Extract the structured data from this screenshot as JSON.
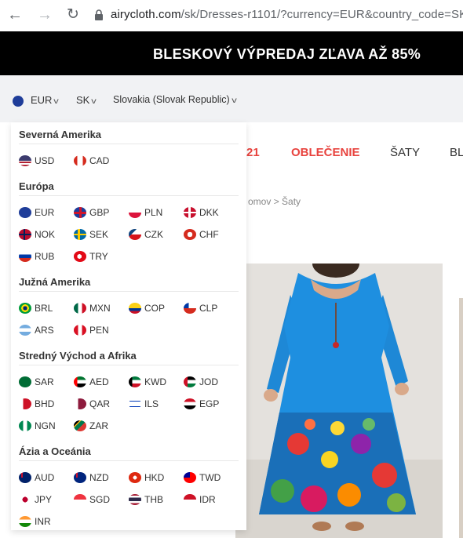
{
  "browser": {
    "back_icon": "←",
    "forward_icon": "→",
    "reload_icon": "↻",
    "url_domain": "airycloth.com",
    "url_path": "/sk/Dresses-r1101/?currency=EUR&country_code=SK"
  },
  "banner": {
    "text": "BLESKOVÝ VÝPREDAJ ZĽAVA AŽ 85%"
  },
  "locale": {
    "currency": "EUR",
    "language": "SK",
    "country": "Slovakia (Slovak Republic)"
  },
  "nav": {
    "partial_item": "21",
    "items": [
      {
        "label": "OBLEČENIE",
        "active": true
      },
      {
        "label": "ŠATY",
        "active": false
      },
      {
        "label": "BL",
        "active": false
      }
    ]
  },
  "breadcrumb": {
    "prev_partial": "omov",
    "separator": ">",
    "current": "Šaty"
  },
  "dropdown": {
    "regions": [
      {
        "name": "Severná Amerika",
        "currencies": [
          {
            "code": "USD",
            "flag": "us"
          },
          {
            "code": "CAD",
            "flag": "ca"
          }
        ]
      },
      {
        "name": "Európa",
        "currencies": [
          {
            "code": "EUR",
            "flag": "eu"
          },
          {
            "code": "GBP",
            "flag": "gb"
          },
          {
            "code": "PLN",
            "flag": "pl"
          },
          {
            "code": "DKK",
            "flag": "dk"
          },
          {
            "code": "NOK",
            "flag": "no"
          },
          {
            "code": "SEK",
            "flag": "se"
          },
          {
            "code": "CZK",
            "flag": "cz"
          },
          {
            "code": "CHF",
            "flag": "ch"
          },
          {
            "code": "RUB",
            "flag": "ru"
          },
          {
            "code": "TRY",
            "flag": "tr"
          }
        ]
      },
      {
        "name": "Južná Amerika",
        "currencies": [
          {
            "code": "BRL",
            "flag": "br"
          },
          {
            "code": "MXN",
            "flag": "mx"
          },
          {
            "code": "COP",
            "flag": "co"
          },
          {
            "code": "CLP",
            "flag": "cl"
          },
          {
            "code": "ARS",
            "flag": "ar"
          },
          {
            "code": "PEN",
            "flag": "pe"
          }
        ]
      },
      {
        "name": "Stredný Východ a Afrika",
        "currencies": [
          {
            "code": "SAR",
            "flag": "sa"
          },
          {
            "code": "AED",
            "flag": "ae"
          },
          {
            "code": "KWD",
            "flag": "kw"
          },
          {
            "code": "JOD",
            "flag": "jo"
          },
          {
            "code": "BHD",
            "flag": "bh"
          },
          {
            "code": "QAR",
            "flag": "qa"
          },
          {
            "code": "ILS",
            "flag": "il"
          },
          {
            "code": "EGP",
            "flag": "eg"
          },
          {
            "code": "NGN",
            "flag": "ng"
          },
          {
            "code": "ZAR",
            "flag": "za"
          }
        ]
      },
      {
        "name": "Ázia a Oceánia",
        "currencies": [
          {
            "code": "AUD",
            "flag": "au"
          },
          {
            "code": "NZD",
            "flag": "nz"
          },
          {
            "code": "HKD",
            "flag": "hk"
          },
          {
            "code": "TWD",
            "flag": "tw"
          },
          {
            "code": "JPY",
            "flag": "jp"
          },
          {
            "code": "SGD",
            "flag": "sg"
          },
          {
            "code": "THB",
            "flag": "th"
          },
          {
            "code": "IDR",
            "flag": "id"
          },
          {
            "code": "INR",
            "flag": "in"
          }
        ]
      }
    ]
  },
  "colors": {
    "accent": "#e8433e",
    "banner_bg": "#000000",
    "locale_bg": "#f1f2f4"
  }
}
